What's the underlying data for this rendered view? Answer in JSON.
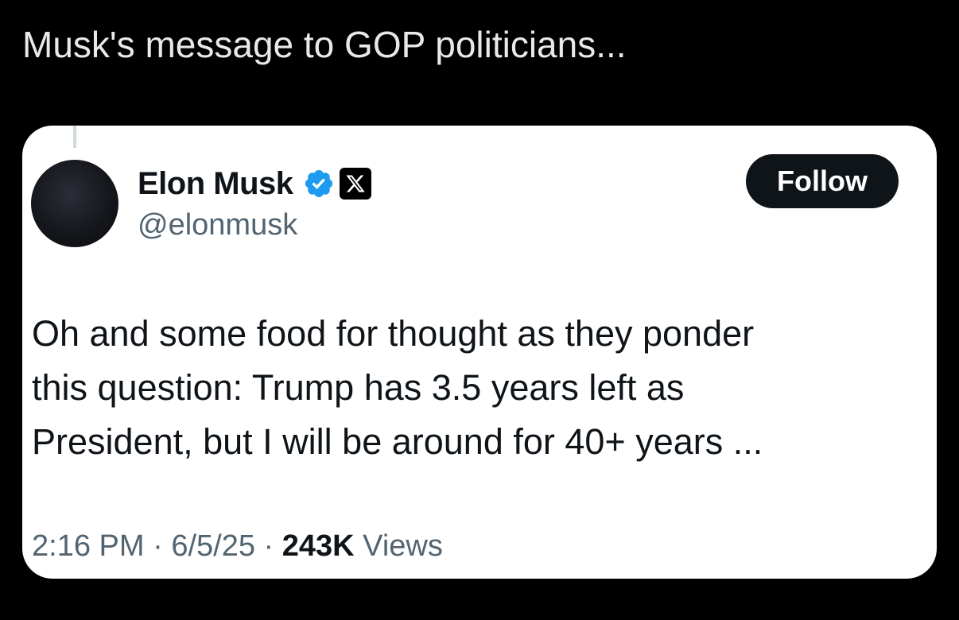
{
  "caption": "Musk's message to GOP politicians...",
  "tweet": {
    "display_name": "Elon Musk",
    "handle": "@elonmusk",
    "follow_label": "Follow",
    "text_lines": [
      "Oh and some food for thought as they ponder",
      "this question: Trump has 3.5 years left as",
      "President, but I will be around for 40+ years ..."
    ],
    "time": "2:16 PM",
    "separator": "·",
    "date": "6/5/25",
    "views_count": "243K",
    "views_label": "Views",
    "icons": {
      "verified": "verified-badge-icon",
      "affiliate": "x-logo-icon"
    },
    "colors": {
      "verified_blue": "#1d9bf0",
      "text": "#0f1419",
      "muted": "#536471",
      "button_bg": "#0f1419"
    }
  }
}
